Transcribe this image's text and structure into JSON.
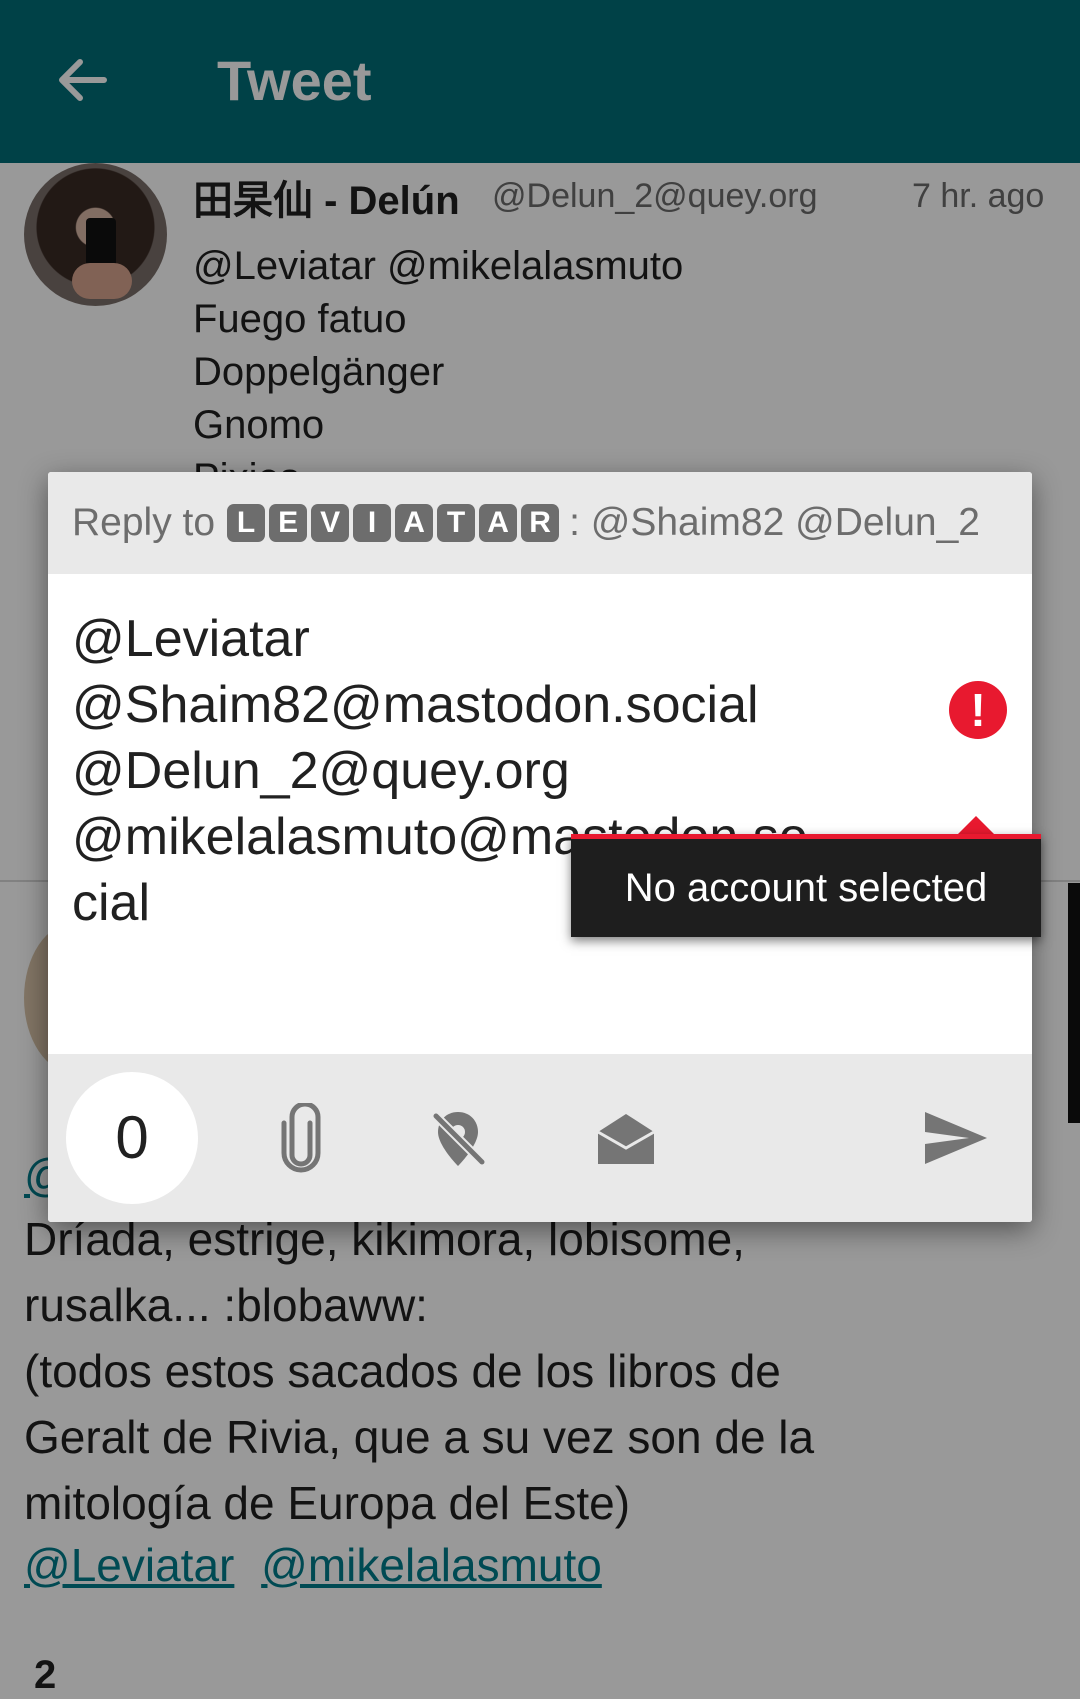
{
  "appbar": {
    "title": "Tweet",
    "back_icon": "arrow-left-icon",
    "background": "#006d77"
  },
  "timeline": {
    "tweet1": {
      "author_name": "田杲仙 - Delún",
      "handle": "@Delun_2@quey.org",
      "time": "7 hr. ago",
      "lines": [
        "@Leviatar @mikelalasmuto",
        "Fuego fatuo",
        "Doppelgänger",
        "Gnomo",
        "Pixies"
      ]
    },
    "tweet2": {
      "partial_mention": "@",
      "lines": [
        "Dríada, estrige, kikimora, lobisome,",
        "rusalka... :blobaww:",
        "(todos estos sacados de los libros de",
        "Geralt de Rivia, que a su vez son de la",
        "mitología de Europa del Este)"
      ],
      "mentions": [
        "@Leviatar",
        "@mikelalasmuto"
      ],
      "count": "2",
      "link_color": "#007c8a"
    }
  },
  "dialog": {
    "reply_prefix": "Reply to",
    "reply_badges": [
      "L",
      "E",
      "V",
      "I",
      "A",
      "T",
      "A",
      "R"
    ],
    "reply_suffix": ": @Shaim82 @Delun_2",
    "editor_lines": [
      "@Leviatar",
      "@Shaim82@mastodon.social",
      "@Delun_2@quey.org",
      "@mikelalasmuto@mastodon.so",
      "cial"
    ],
    "error_icon": "alert-circle-icon",
    "error_message": "No account selected",
    "error_color": "#e8192f",
    "char_count": "0",
    "toolbar_icons": [
      "paperclip-icon",
      "location-off-icon",
      "envelope-open-icon",
      "send-icon"
    ]
  }
}
